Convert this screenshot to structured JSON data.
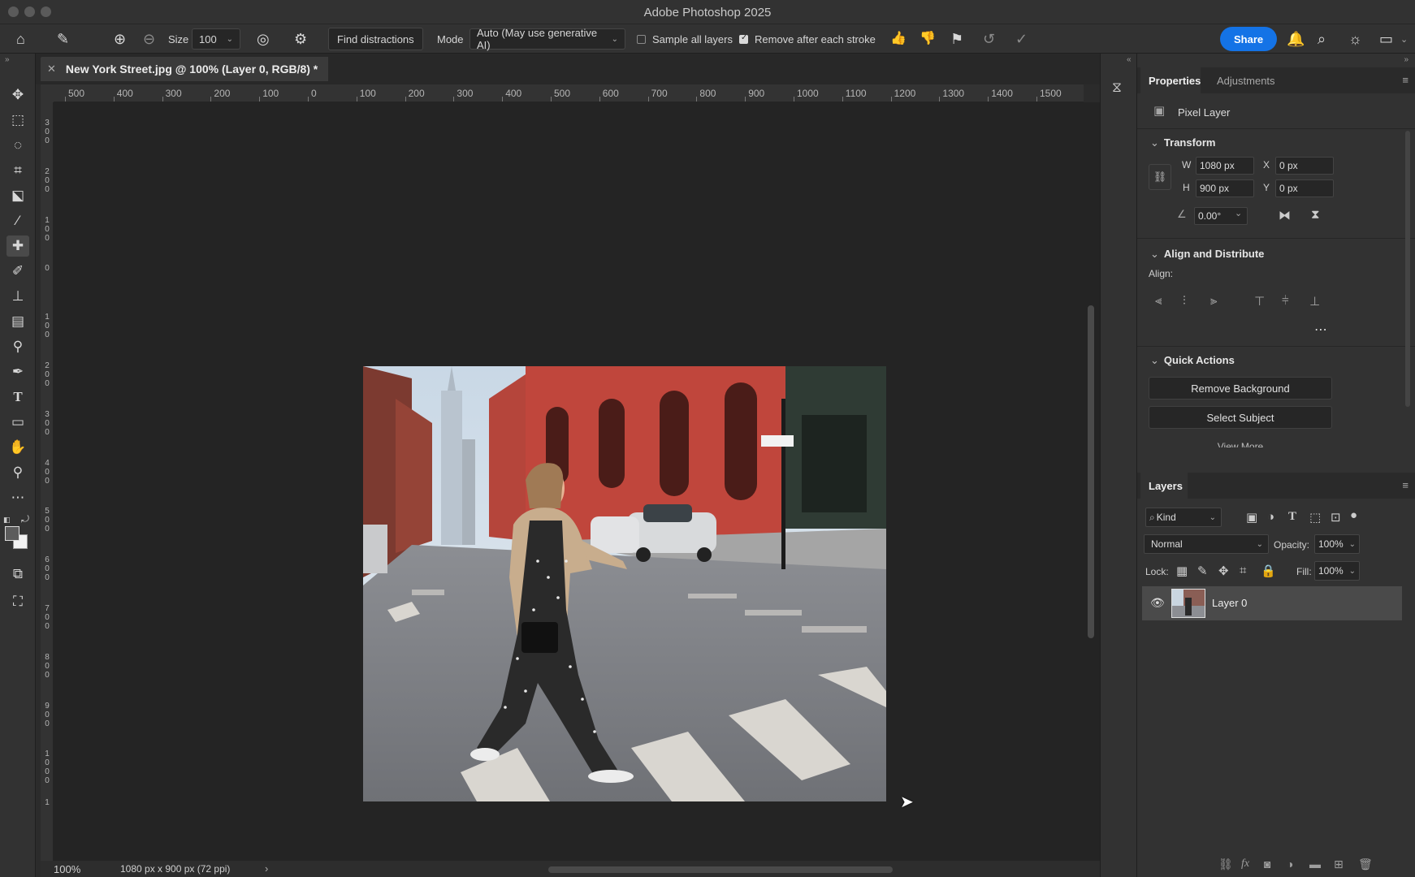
{
  "window": {
    "title": "Adobe Photoshop 2025"
  },
  "options_bar": {
    "size_label": "Size",
    "size_value": "100",
    "find_distractions": "Find distractions",
    "mode_label": "Mode",
    "mode_value": "Auto (May use generative AI)",
    "sample_all_layers": "Sample all layers",
    "sample_all_layers_checked": false,
    "remove_after_each_stroke": "Remove after each stroke",
    "remove_after_each_stroke_checked": true,
    "share": "Share"
  },
  "document": {
    "tab_title": "New York Street.jpg @ 100% (Layer 0, RGB/8) *",
    "zoom": "100%",
    "info": "1080 px x 900 px (72 ppi)"
  },
  "ruler": {
    "h_labels": [
      "500",
      "400",
      "300",
      "200",
      "100",
      "0",
      "100",
      "200",
      "300",
      "400",
      "500",
      "600",
      "700",
      "800",
      "900",
      "1000",
      "1100",
      "1200",
      "1300",
      "1400",
      "1500"
    ],
    "v_labels": [
      "300",
      "200",
      "100",
      "0",
      "100",
      "200",
      "300",
      "400",
      "500",
      "600",
      "700",
      "800",
      "900",
      "1000",
      "1"
    ]
  },
  "properties": {
    "tab_properties": "Properties",
    "tab_adjustments": "Adjustments",
    "layer_kind": "Pixel Layer",
    "transform": {
      "title": "Transform",
      "w_label": "W",
      "w": "1080 px",
      "h_label": "H",
      "h": "900 px",
      "x_label": "X",
      "x": "0 px",
      "y_label": "Y",
      "y": "0 px",
      "angle": "0.00°"
    },
    "align": {
      "title": "Align and Distribute",
      "align_label": "Align:"
    },
    "quick_actions": {
      "title": "Quick Actions",
      "remove_background": "Remove Background",
      "select_subject": "Select Subject",
      "view_more": "View More"
    }
  },
  "layers": {
    "tab": "Layers",
    "kind": "Kind",
    "blend_mode": "Normal",
    "opacity_label": "Opacity:",
    "opacity": "100%",
    "lock_label": "Lock:",
    "fill_label": "Fill:",
    "fill": "100%",
    "items": [
      {
        "name": "Layer 0",
        "visible": true
      }
    ]
  }
}
